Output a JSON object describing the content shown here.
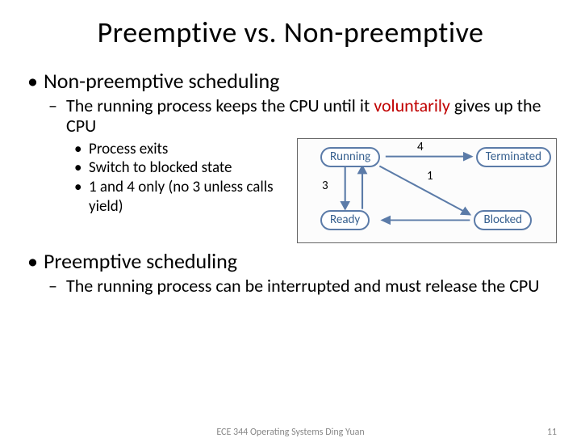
{
  "title": "Preemptive vs. Non-preemptive",
  "bullet1": {
    "heading": "Non-preemptive scheduling",
    "sub1_pre": "The running process keeps the CPU until it ",
    "sub1_highlight": "voluntarily",
    "sub1_post": " gives up the CPU",
    "sub_items": [
      "Process exits",
      "Switch to blocked state",
      "1 and 4 only (no 3 unless calls yield)"
    ]
  },
  "bullet2": {
    "heading": "Preemptive scheduling",
    "sub1": "The running process can be interrupted and must release the CPU"
  },
  "diagram": {
    "nodes": {
      "running": "Running",
      "terminated": "Terminated",
      "ready": "Ready",
      "blocked": "Blocked"
    },
    "edges": {
      "e1": "1",
      "e3": "3",
      "e4": "4"
    }
  },
  "footer": "ECE 344 Operating Systems Ding Yuan",
  "page": "11"
}
